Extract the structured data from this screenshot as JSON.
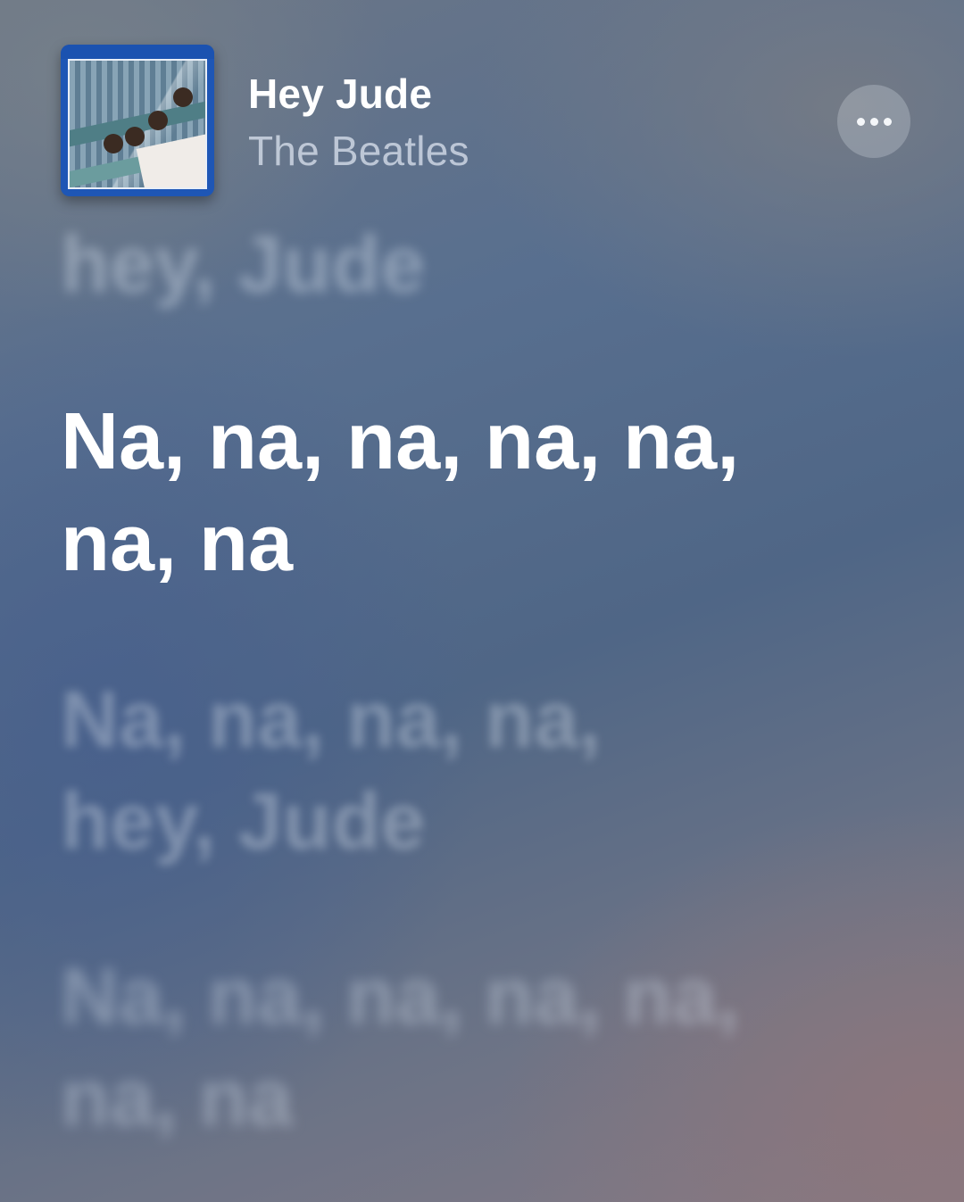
{
  "now_playing": {
    "title": "Hey Jude",
    "artist": "The Beatles",
    "album_art_icon": "album-cover-thumbnail",
    "more_icon": "ellipsis-icon"
  },
  "lyrics": {
    "previous_line": [
      "hey, Jude"
    ],
    "current_line": [
      "Na, na, na, na, na,",
      "na, na"
    ],
    "upcoming_lines": [
      [
        "Na, na, na, na,",
        "hey, Jude"
      ],
      [
        "Na, na, na, na, na,",
        "na, na"
      ]
    ]
  },
  "colors": {
    "current_lyric": "#ffffff",
    "dimmed_lyric": "#cdd6e4",
    "background_blue": "#4f6686",
    "background_mauve": "#857a84",
    "album_border": "#1e56b5"
  }
}
